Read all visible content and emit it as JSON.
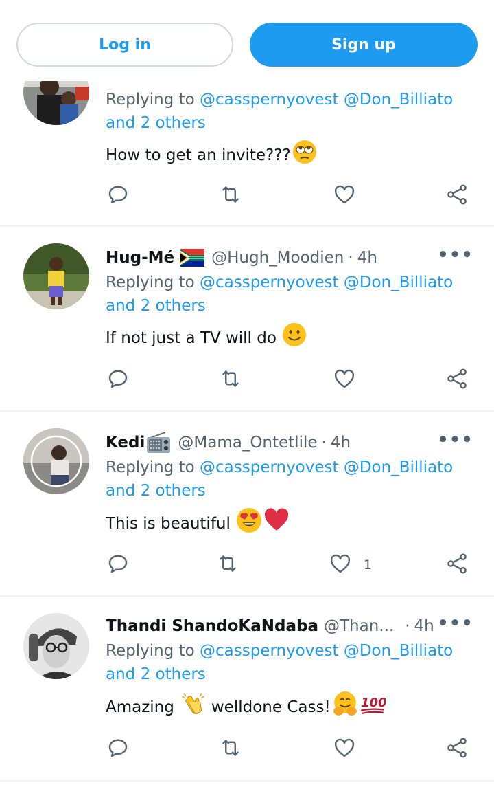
{
  "auth": {
    "login_label": "Log in",
    "signup_label": "Sign up"
  },
  "colors": {
    "accent": "#1d9bf0",
    "muted": "#536471",
    "text": "#0f1419",
    "divider": "#eff3f4"
  },
  "tweets": [
    {
      "name": "",
      "badge_icon": "",
      "handle": "",
      "dot": "",
      "time": "",
      "more": "",
      "reply_prefix": "Replying to ",
      "reply_users": "@casspernyovest @Don_Billiato",
      "reply_suffix": "and 2 others",
      "text": "How to get an invite???",
      "emoji_icons": [
        "face-with-rolling-eyes"
      ],
      "like_count": ""
    },
    {
      "name": "Hug-Mé",
      "badge_icon": "south-africa-flag",
      "handle": "@Hugh_Moodien",
      "dot": "·",
      "time": "4h",
      "more": "•••",
      "reply_prefix": "Replying to ",
      "reply_users": "@casspernyovest @Don_Billiato",
      "reply_suffix": "and 2 others",
      "text": "If not just a TV will do",
      "emoji_icons": [
        "slightly-smiling-face"
      ],
      "like_count": ""
    },
    {
      "name": "Kedi",
      "badge_icon": "radio",
      "handle": "@Mama_Ontetlile",
      "dot": "·",
      "time": "4h",
      "more": "•••",
      "reply_prefix": "Replying to ",
      "reply_users": "@casspernyovest @Don_Billiato",
      "reply_suffix": "and 2 others",
      "text": "This is beautiful",
      "emoji_icons": [
        "heart-eyes-face",
        "red-heart"
      ],
      "like_count": "1"
    },
    {
      "name": "Thandi ShandoKaNdaba",
      "badge_icon": "",
      "handle": "@Than...",
      "dot": "·",
      "time": "4h",
      "more": "•••",
      "reply_prefix": "Replying to ",
      "reply_users": "@casspernyovest @Don_Billiato",
      "reply_suffix": "and 2 others",
      "text": "Amazing",
      "text_after": "welldone Cass!",
      "emoji_icons": [
        "clapping-hands",
        "hugging-face",
        "hundred-points"
      ],
      "like_count": ""
    }
  ]
}
